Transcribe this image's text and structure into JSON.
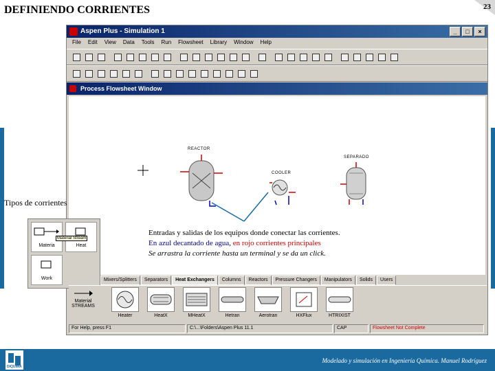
{
  "slide": {
    "title": "DEFINIENDO CORRIENTES",
    "page": "23"
  },
  "window": {
    "title": "Aspen Plus - Simulation 1",
    "menu": [
      "File",
      "Edit",
      "View",
      "Data",
      "Tools",
      "Run",
      "Flowsheet",
      "Library",
      "Window",
      "Help"
    ],
    "flowsheet_title": "Process Flowsheet Window"
  },
  "flowsheet": {
    "reactor_label": "REACTOR",
    "cooler_label": "COOLER",
    "separator_label": "SEPARADO"
  },
  "callout_streams": "Tipos de corrientes",
  "stream_palette": {
    "material": "Materia",
    "heat": "Heat",
    "work": "Work",
    "tooltip": "Material Stream"
  },
  "note": {
    "line1": "Entradas y salidas de los equipos donde conectar las corrientes.",
    "line2_blue": "En azul decantado de agua",
    "line2_sep": ", ",
    "line2_red": "en rojo corrientes principales",
    "line3": "Se arrastra la corriente hasta un terminal y se da un click."
  },
  "tabs": [
    "Mixers/Splitters",
    "Separators",
    "Heat Exchangers",
    "Columns",
    "Reactors",
    "Pressure Changers",
    "Manipulators",
    "Solids",
    "Users"
  ],
  "models": {
    "streams_top": "Material",
    "streams_bottom": "STREAMS",
    "items": [
      "Heater",
      "HeatX",
      "MHeatX",
      "Hetran",
      "Aerotran",
      "HXFlux",
      "HTRIXIST"
    ]
  },
  "status": {
    "help": "For Help, press F1",
    "folder": "C:\\...\\Folders\\Aspen Plus 11.1",
    "cap": "CAP",
    "flowsheet": "Flowsheet Not Complete"
  },
  "footer": {
    "text": "Modelado y simulación en Ingeniería Química. Manuel Rodríguez",
    "logo": "DIQUIMA"
  },
  "colors": {
    "accent": "#1a6aa0",
    "title_bar": "#0a246a",
    "red": "#cc0000",
    "blue": "#00008b"
  }
}
